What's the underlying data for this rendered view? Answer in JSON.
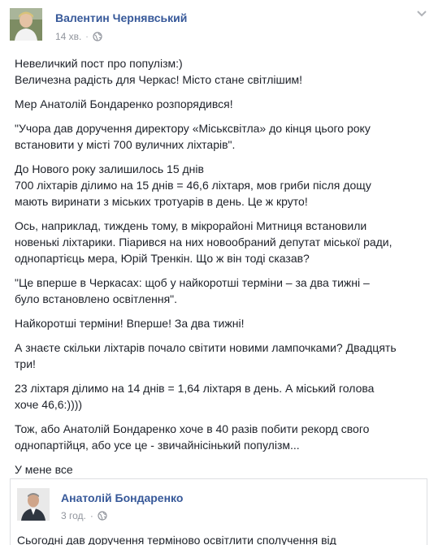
{
  "post": {
    "author": "Валентин Чернявський",
    "time": "14 хв.",
    "separator": "·",
    "icons": {
      "audience": "globe-icon",
      "menu": "chevron-down-icon"
    },
    "paragraphs": [
      "Невеличкий пост про популізм:)\nВеличезна радість для Черкас! Місто стане світлішим!",
      "Мер Анатолій Бондаренко розпорядився!",
      "\"Учора дав доручення директору «Міськсвітла» до кінця цього року\nвстановити у місті 700 вуличних ліхтарів\".",
      "До Нового року залишилось 15 днів\n700 ліхтарів ділимо на 15 днів = 46,6 ліхтаря, мов гриби після дощу\nмають виринати з міських тротуарів в день. Це ж круто!",
      "Ось, наприклад, тиждень тому, в мікрорайоні Митниця встановили\nновенькі ліхтарики. Піарився на них новообраний депутат міської ради,\nоднопартієць мера, Юрій Тренкін. Що ж він тоді сказав?",
      "\"Це вперше в Черкасах: щоб у найкоротші терміни – за два тижні –\nбуло встановлено освітлення\".",
      "Найкоротші терміни! Вперше! За два тижні!",
      "А знаєте скільки ліхтарів почало світити новими лампочками? Двадцять\nтри!",
      "23 ліхтаря ділимо на 14 днів = 1,64 ліхтаря в день. А міський голова\nхоче 46,6:))))",
      "Тож, або Анатолій Бондаренко хоче в 40 разів побити рекорд свого\nоднопартійця, або усе це - звичайнісінький популізм...",
      "У мене все"
    ]
  },
  "shared_post": {
    "author": "Анатолій Бондаренко",
    "time": "3 год.",
    "separator": "·",
    "text": "Сьогодні дав доручення терміново освітлити сполучення від"
  },
  "colors": {
    "link": "#365899",
    "meta": "#90949c",
    "text": "#1d2129",
    "border": "#dddfe2"
  }
}
